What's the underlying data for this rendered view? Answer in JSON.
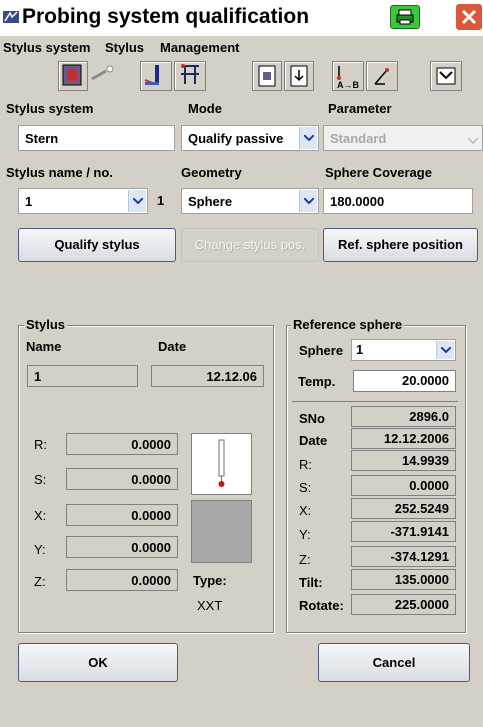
{
  "window": {
    "title": "Probing system qualification"
  },
  "menu": {
    "items": [
      "Stylus system",
      "Stylus",
      "Management"
    ]
  },
  "toolbar": {
    "icons": [
      "stylus-system-icon",
      "stylus-probe-icon",
      "change-stylus-icon",
      "multi-stylus-icon",
      "export-icon",
      "import-icon",
      "ab-transform-icon",
      "axis-arrow-icon",
      "probe-head-icon"
    ]
  },
  "top": {
    "stylus_system_label": "Stylus system",
    "mode_label": "Mode",
    "parameter_label": "Parameter",
    "stylus_system_value": "Stern",
    "mode_value": "Qualify passive",
    "parameter_value": "Standard",
    "stylus_name_label": "Stylus name / no.",
    "geometry_label": "Geometry",
    "sphere_coverage_label": "Sphere Coverage",
    "stylus_name_value": "1",
    "stylus_no_value": "1",
    "geometry_value": "Sphere",
    "sphere_coverage_value": "180.0000"
  },
  "buttons": {
    "qualify_stylus": "Qualify stylus",
    "change_stylus_pos": "Change stylus pos.",
    "ref_sphere_position": "Ref. sphere position",
    "ok": "OK",
    "cancel": "Cancel"
  },
  "stylus": {
    "title": "Stylus",
    "name_label": "Name",
    "date_label": "Date",
    "name_value": "1",
    "date_value": "12.12.06",
    "fields": [
      {
        "label": "R:",
        "value": "0.0000"
      },
      {
        "label": "S:",
        "value": "0.0000"
      },
      {
        "label": "X:",
        "value": "0.0000"
      },
      {
        "label": "Y:",
        "value": "0.0000"
      },
      {
        "label": "Z:",
        "value": "0.0000"
      }
    ],
    "type_label": "Type:",
    "type_value": "XXT"
  },
  "reference_sphere": {
    "title": "Reference sphere",
    "sphere_label": "Sphere",
    "sphere_value": "1",
    "temp_label": "Temp.",
    "temp_value": "20.0000",
    "fields": [
      {
        "label": "SNo",
        "value": "2896.0"
      },
      {
        "label": "Date",
        "value": "12.12.2006"
      },
      {
        "label": "R:",
        "value": "14.9939"
      },
      {
        "label": "S:",
        "value": "0.0000"
      },
      {
        "label": "X:",
        "value": "252.5249"
      },
      {
        "label": "Y:",
        "value": "-371.9141"
      },
      {
        "label": "Z:",
        "value": "-374.1291"
      },
      {
        "label": "Tilt:",
        "value": "135.0000"
      },
      {
        "label": "Rotate:",
        "value": "225.0000"
      }
    ]
  }
}
